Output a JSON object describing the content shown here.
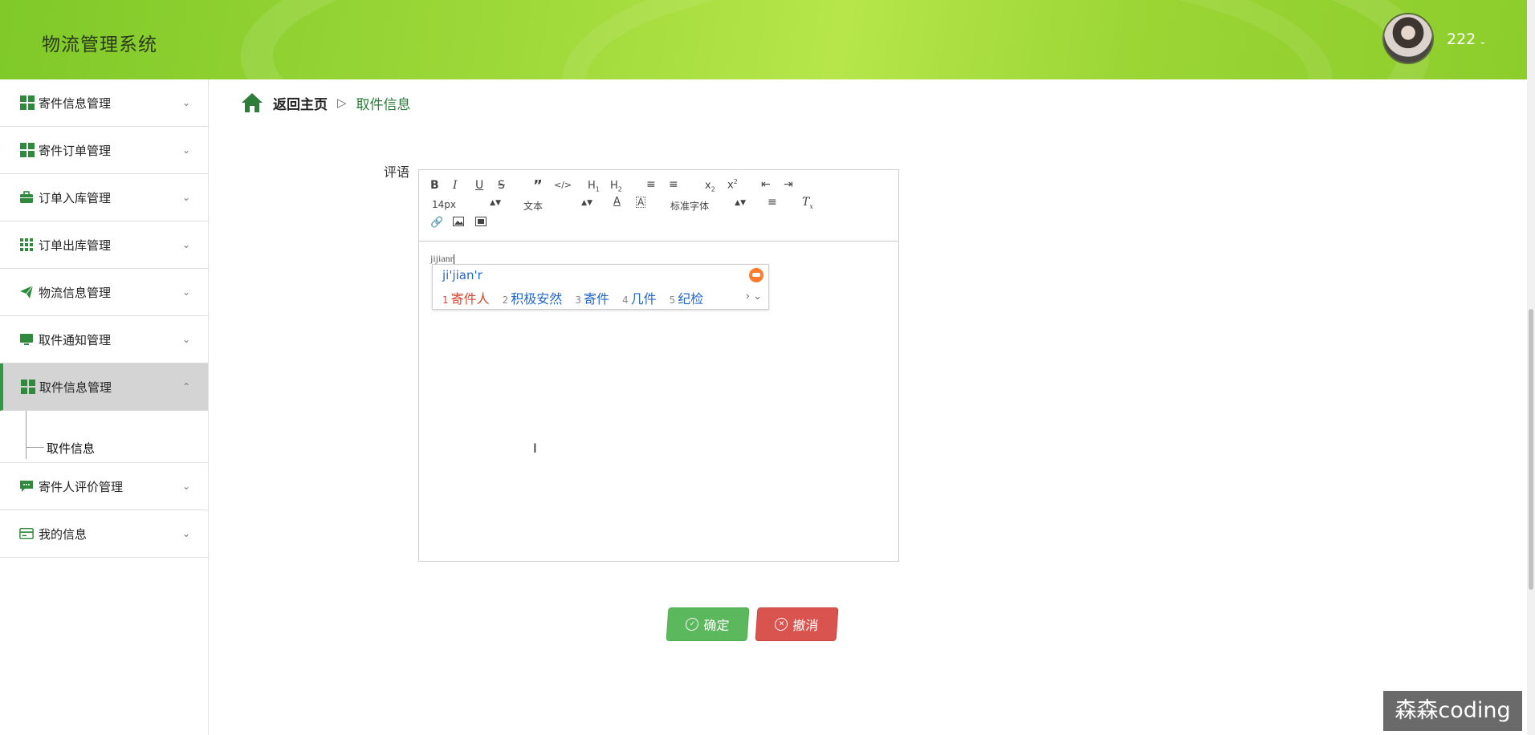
{
  "app": {
    "title": "物流管理系统"
  },
  "user": {
    "name": "222"
  },
  "sidebar": {
    "items": [
      {
        "label": "寄件信息管理",
        "icon": "grid-icon",
        "expanded": false
      },
      {
        "label": "寄件订单管理",
        "icon": "grid-icon",
        "expanded": false
      },
      {
        "label": "订单入库管理",
        "icon": "briefcase-icon",
        "expanded": false
      },
      {
        "label": "订单出库管理",
        "icon": "grid-nine-icon",
        "expanded": false
      },
      {
        "label": "物流信息管理",
        "icon": "paper-plane-icon",
        "expanded": false
      },
      {
        "label": "取件通知管理",
        "icon": "monitor-icon",
        "expanded": false
      },
      {
        "label": "取件信息管理",
        "icon": "grid-icon",
        "expanded": true
      },
      {
        "label": "寄件人评价管理",
        "icon": "comment-icon",
        "expanded": false
      },
      {
        "label": "我的信息",
        "icon": "id-card-icon",
        "expanded": false
      }
    ],
    "submenu": {
      "label": "取件信息"
    }
  },
  "breadcrumb": {
    "home": "返回主页",
    "separator": "▷",
    "current": "取件信息"
  },
  "form": {
    "field_label": "评语",
    "editor": {
      "font_size": "14px",
      "block_type": "文本",
      "font_family": "标准字体",
      "content": "jijianr"
    }
  },
  "ime": {
    "composition": "ji'jian'r",
    "candidates": [
      {
        "num": "1",
        "text": "寄件人"
      },
      {
        "num": "2",
        "text": "积极安然"
      },
      {
        "num": "3",
        "text": "寄件"
      },
      {
        "num": "4",
        "text": "几件"
      },
      {
        "num": "5",
        "text": "纪检"
      }
    ]
  },
  "buttons": {
    "confirm": "确定",
    "cancel": "撤消"
  },
  "watermark": "森森coding",
  "colors": {
    "accent": "#2f9a43",
    "header": "#9fd93a",
    "confirm": "#5cb85c",
    "cancel": "#d9534f"
  }
}
